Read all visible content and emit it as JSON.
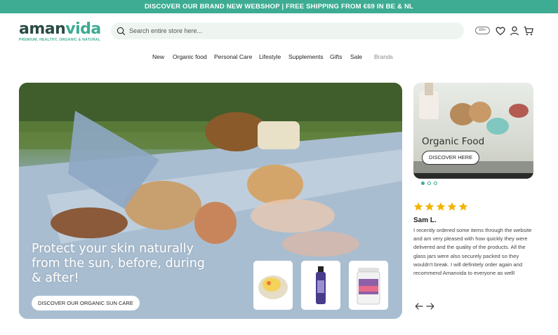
{
  "announcement": "DISCOVER OUR BRAND NEW WEBSHOP | FREE SHIPPING FROM €69 IN BE & NL",
  "brand": {
    "name_part1": "aman",
    "name_part2": "vida",
    "tagline": "PREMIUM, HEALTHY, ORGANIC & NATURAL"
  },
  "search": {
    "placeholder": "Search entire store here..."
  },
  "header": {
    "language": "EN",
    "icons": [
      "globe-language-icon",
      "heart-icon",
      "user-icon",
      "cart-icon"
    ]
  },
  "nav": {
    "items": [
      "New",
      "Organic food",
      "Personal Care",
      "Lifestyle",
      "Supplements",
      "Gifts",
      "Sale",
      "Brands"
    ]
  },
  "hero": {
    "title": "Protect your skin naturally from the sun, before, during & after!",
    "button": "DISCOVER OUR ORGANIC SUN CARE",
    "products": [
      "sun-balm-tin",
      "sun-oil-bottle",
      "supplement-tub"
    ]
  },
  "side_card": {
    "title": "Organic Food",
    "button": "DISCOVER HERE"
  },
  "carousel": {
    "active_index": 0,
    "count": 3
  },
  "review": {
    "rating": 5,
    "name": "Sam L.",
    "text": "I recently ordered some items through the website and am very pleased with how quickly they were delivered and the quality of the products. All the glass jars were also securely packed so they wouldn't break. I will definitely order again and recommend Amanvida to everyone as well!"
  },
  "colors": {
    "accent": "#3dac92",
    "star": "#f2b400",
    "dark": "#2b4b44"
  }
}
